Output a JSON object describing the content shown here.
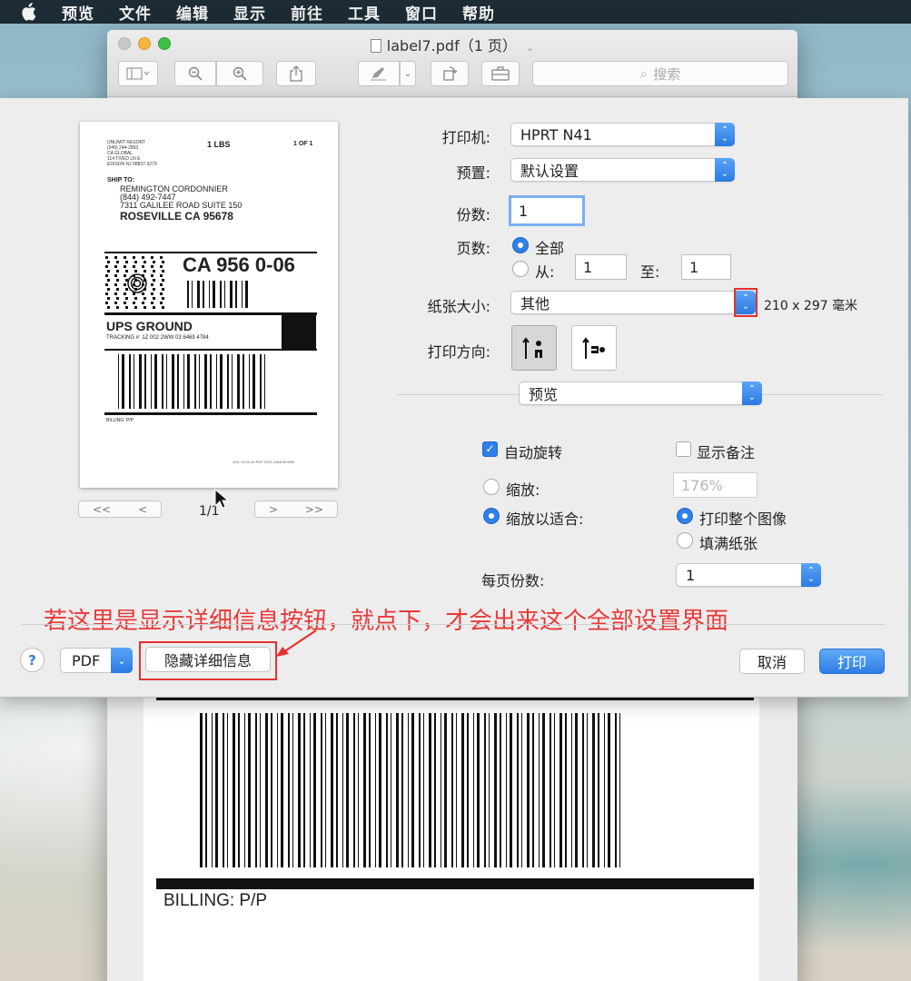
{
  "menubar": {
    "items": [
      "预览",
      "文件",
      "编辑",
      "显示",
      "前往",
      "工具",
      "窗口",
      "帮助"
    ]
  },
  "window": {
    "title": "label7.pdf（1 页）",
    "search_placeholder": "搜索"
  },
  "label": {
    "weight": "1 LBS",
    "page_of": "1 OF 1",
    "sender_lines": [
      "UNLIMIT RESORT",
      "(949) 244-2893",
      "CA GLOBAL",
      "114 TIVED LN E",
      "EDISON  NJ 08837-3279"
    ],
    "ship_to_label": "SHIP TO:",
    "recipient_lines": [
      "REMINGTON CORDONNIER",
      "(844) 492-7447",
      "7311 GALILEE ROAD SUITE 150"
    ],
    "city": "ROSEVILLE  CA 95678",
    "routing_code": "CA 956 0-06",
    "service": "UPS GROUND",
    "tracking": "TRACKING #: 1Z 002 2WW 03 6469 4784",
    "billing_small": "BILLING: P/P",
    "billing_big": "BILLING: P/P"
  },
  "thumbnail_nav": {
    "first": "<<",
    "prev": "<",
    "indicator": "1/1",
    "next": ">",
    "last": ">>"
  },
  "dialog": {
    "printer_label": "打印机:",
    "printer_value": "HPRT N41",
    "presets_label": "预置:",
    "presets_value": "默认设置",
    "copies_label": "份数:",
    "copies_value": "1",
    "pages_label": "页数:",
    "pages_all": "全部",
    "pages_from": "从:",
    "pages_from_value": "1",
    "pages_to": "至:",
    "pages_to_value": "1",
    "paper_label": "纸张大小:",
    "paper_value": "其他",
    "paper_dims": "210 x 297 毫米",
    "orientation_label": "打印方向:",
    "section_value": "预览",
    "auto_rotate": "自动旋转",
    "show_notes": "显示备注",
    "scale": "缩放:",
    "scale_value": "176%",
    "scale_to_fit": "缩放以适合:",
    "print_entire_image": "打印整个图像",
    "fill_paper": "填满纸张",
    "copies_per_page_label": "每页份数:",
    "copies_per_page_value": "1",
    "help": "?",
    "pdf": "PDF",
    "hide_details": "隐藏详细信息",
    "cancel": "取消",
    "print": "打印"
  },
  "annotation": {
    "text": "若这里是显示详细信息按钮，就点下，才会出来这个全部设置界面",
    "color": "#e53030"
  },
  "colors": {
    "accent": "#2f80e8",
    "annotation_red": "#e53030"
  }
}
